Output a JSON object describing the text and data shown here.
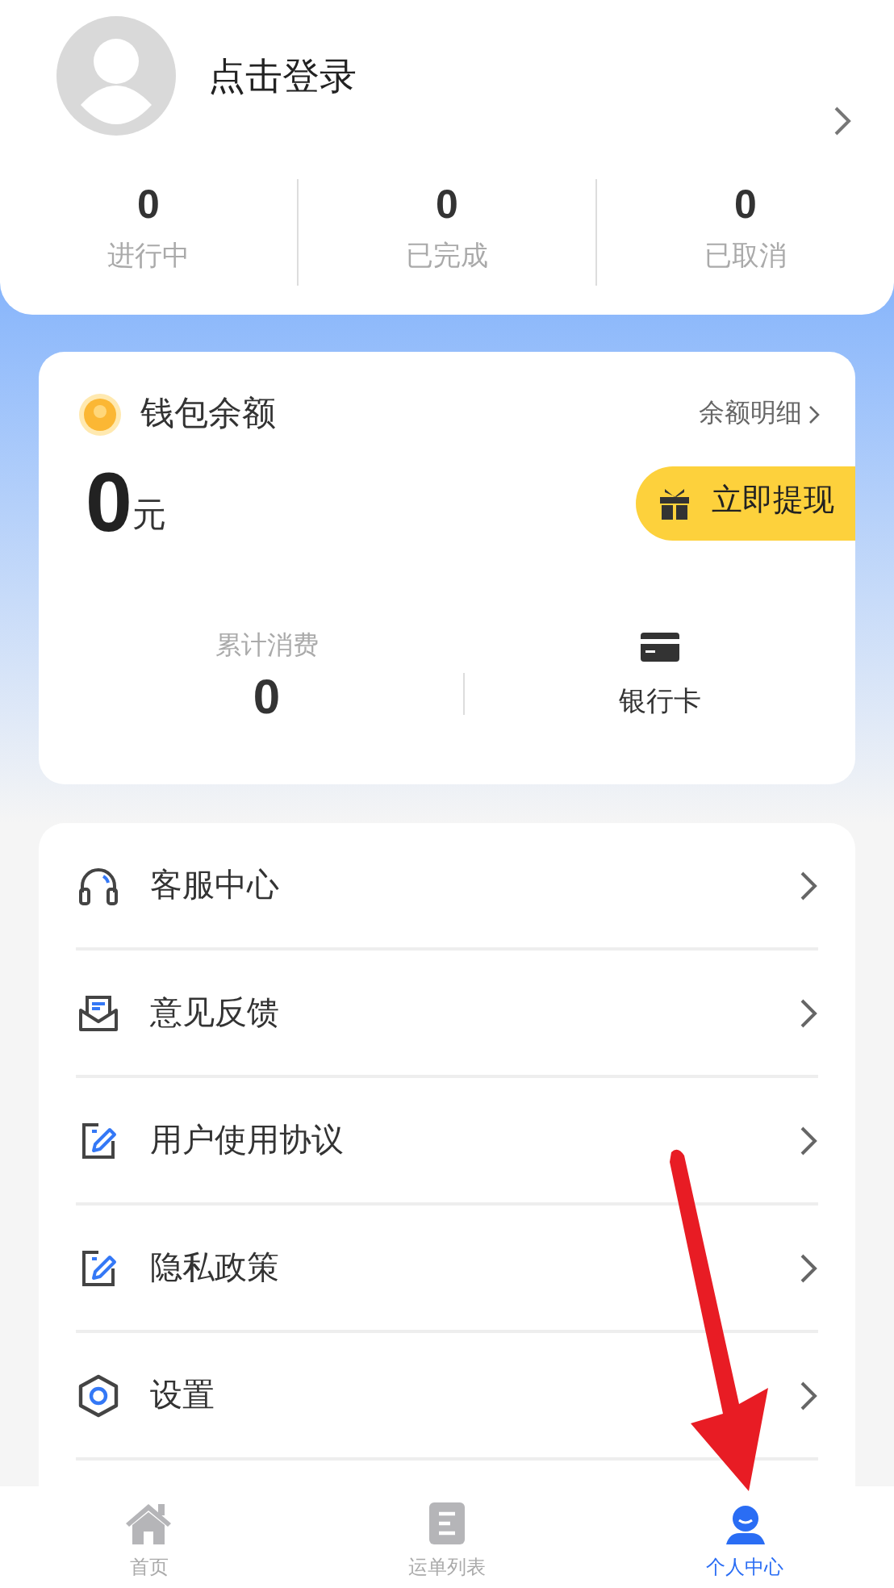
{
  "profile": {
    "login_label": "点击登录"
  },
  "order_stats": [
    {
      "count": "0",
      "label": "进行中"
    },
    {
      "count": "0",
      "label": "已完成"
    },
    {
      "count": "0",
      "label": "已取消"
    }
  ],
  "wallet": {
    "title": "钱包余额",
    "detail_link": "余额明细",
    "amount": "0",
    "unit": "元",
    "withdraw_button": "立即提现",
    "total_spent_label": "累计消费",
    "total_spent": "0",
    "bank_card_label": "银行卡"
  },
  "menu": [
    {
      "kind": "headset",
      "label": "客服中心"
    },
    {
      "kind": "mail",
      "label": "意见反馈"
    },
    {
      "kind": "edit",
      "label": "用户使用协议"
    },
    {
      "kind": "edit",
      "label": "隐私政策"
    },
    {
      "kind": "settings",
      "label": "设置"
    }
  ],
  "tabs": [
    {
      "kind": "home",
      "label": "首页",
      "selected": false
    },
    {
      "kind": "list",
      "label": "运单列表",
      "selected": false
    },
    {
      "kind": "person",
      "label": "个人中心",
      "selected": true
    }
  ]
}
